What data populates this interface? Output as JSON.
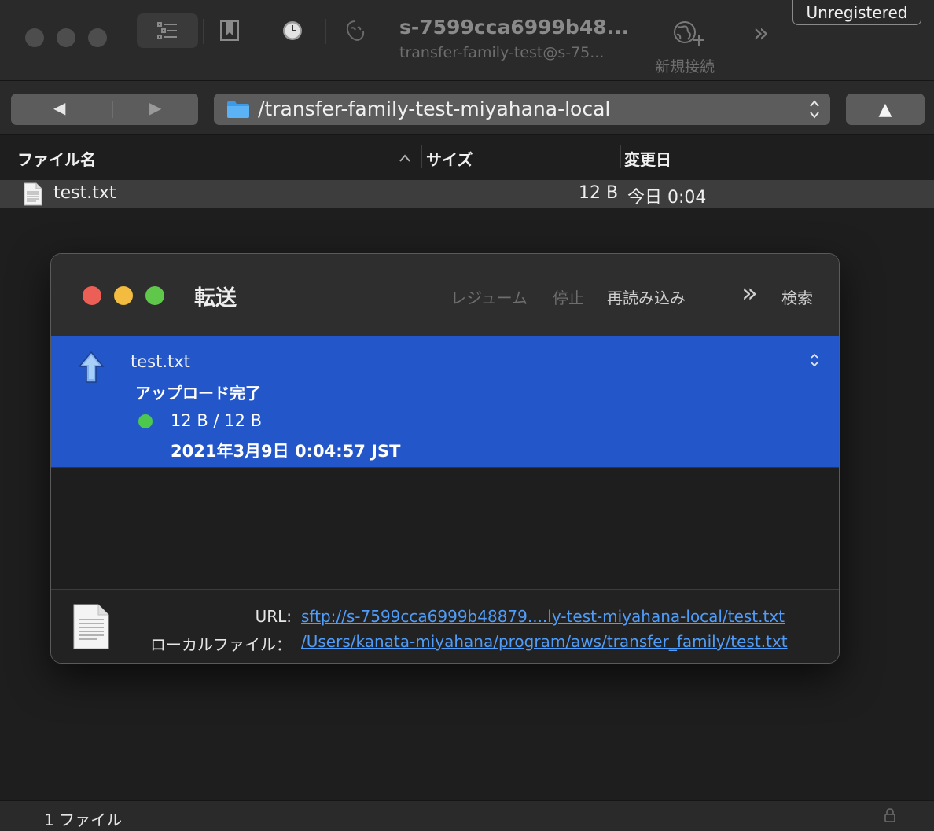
{
  "window": {
    "host_title": "s-7599cca6999b48...",
    "host_subtitle": "transfer-family-test@s-75...",
    "new_connection_label": "新規接続",
    "unregistered_label": "Unregistered",
    "overflow_label": "»"
  },
  "pathbar": {
    "back_label": "◀",
    "forward_label": "▶",
    "path": "/transfer-family-test-miyahana-local",
    "stepper": "⌃\n⌄",
    "up_label": "▲"
  },
  "columns": {
    "name": "ファイル名",
    "size": "サイズ",
    "modified": "変更日",
    "sort_caret": "^"
  },
  "files": [
    {
      "name": "test.txt",
      "size": "12 B",
      "modified": "今日 0:04"
    }
  ],
  "status": {
    "count": "1 ファイル"
  },
  "transfer_window": {
    "title": "転送",
    "toolbar": {
      "resume": "レジューム",
      "stop": "停止",
      "reload": "再読み込み",
      "overflow": "»",
      "search": "検索"
    },
    "items": [
      {
        "name": "test.txt",
        "status": "アップロード完了",
        "progress": "12 B / 12 B",
        "progress_fraction": 1.0,
        "date": "2021年3月9日 0:04:57 JST"
      }
    ],
    "footer": {
      "url_label": "URL:",
      "url": "sftp://s-7599cca6999b48879....ly-test-miyahana-local/test.txt",
      "local_label": "ローカルファイル：",
      "local_path": "/Users/kanata-miyahana/program/aws/transfer_family/test.txt"
    }
  },
  "colors": {
    "selection": "#2256c9",
    "link": "#4f9cf9",
    "close": "#ec5f57",
    "minimize": "#f3bb3f",
    "zoom": "#5fc74a",
    "complete_dot": "#4cc94c"
  }
}
